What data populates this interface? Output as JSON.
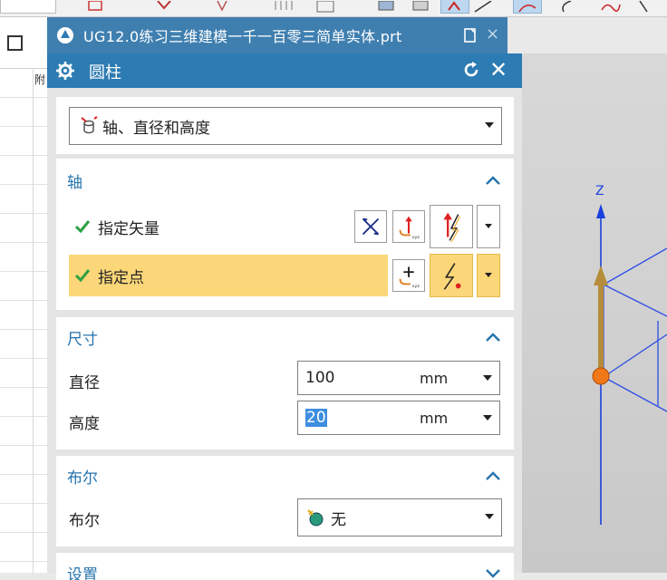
{
  "file_tab": {
    "title": "UG12.0练习三维建模一千一百零三简单实体.prt",
    "close_glyph": "×"
  },
  "left_panel": {
    "header_char": "附"
  },
  "dialog": {
    "title": "圆柱",
    "close_glyph": "✕",
    "type_selector": {
      "selected": "轴、直径和高度",
      "icon": "cylinder-type-icon"
    },
    "axis_section": {
      "title": "轴",
      "rows": [
        {
          "label": "指定矢量",
          "status": "done"
        },
        {
          "label": "指定点",
          "status": "done",
          "highlighted": true
        }
      ]
    },
    "size_section": {
      "title": "尺寸",
      "diameter": {
        "label": "直径",
        "value": "100",
        "unit": "mm"
      },
      "height": {
        "label": "高度",
        "value": "20",
        "unit": "mm",
        "selected": true
      }
    },
    "bool_section": {
      "title": "布尔",
      "label": "布尔",
      "value": "无",
      "icon": "boolean-none-icon"
    },
    "settings_section": {
      "title": "设置"
    }
  },
  "viewport": {
    "axis_label": "Z",
    "colors": {
      "axis_blue": "#1a3fe0",
      "arrow_gold": "#b58d3a",
      "origin_orange": "#f07818",
      "wire_blue": "#2d4fe6"
    }
  },
  "colors": {
    "accent": "#2d7bb3",
    "section_title": "#2573ad",
    "highlight": "#fbd77a",
    "check_green": "#2ea043"
  }
}
